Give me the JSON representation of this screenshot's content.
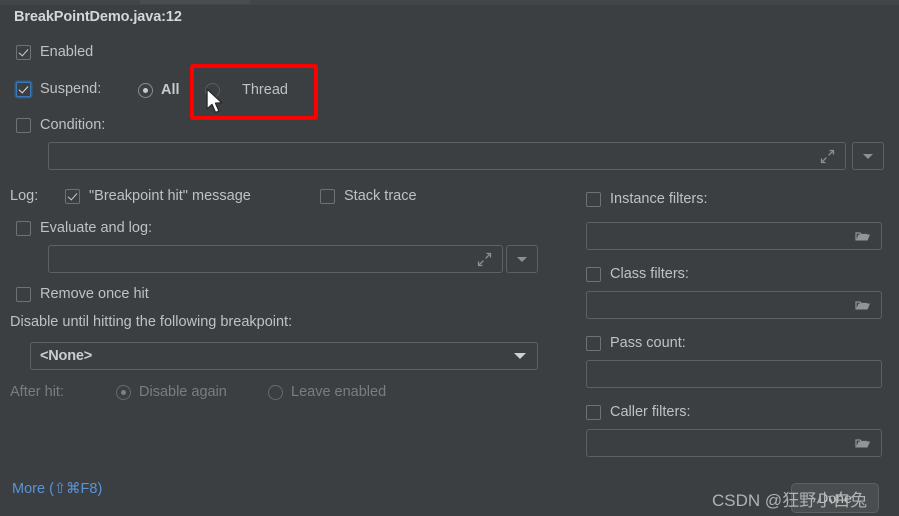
{
  "window": {
    "title": "BreakPointDemo.java:12",
    "background_color": "#3c3f41",
    "accent_color": "#5a93d8",
    "highlight_color": "#ff0000"
  },
  "left_column": {
    "enabled": {
      "label": "Enabled",
      "checked": true
    },
    "suspend": {
      "label": "Suspend:",
      "checked": true,
      "focused": true,
      "options": [
        {
          "label": "All",
          "selected": true
        },
        {
          "label": "Thread",
          "selected": false
        }
      ]
    },
    "condition": {
      "label": "Condition:",
      "checked": false,
      "value": "",
      "expand_icon": "expand-arrows-icon",
      "dropdown_icon": "chevron-down-icon"
    },
    "log": {
      "label": "Log:",
      "breakpoint_hit": {
        "label": "\"Breakpoint hit\" message",
        "checked": true
      },
      "stack_trace": {
        "label": "Stack trace",
        "checked": false
      }
    },
    "evaluate_and_log": {
      "label": "Evaluate and log:",
      "checked": false,
      "value": "",
      "expand_icon": "expand-arrows-icon",
      "dropdown_icon": "chevron-down-icon"
    },
    "remove_once_hit": {
      "label": "Remove once hit",
      "checked": false
    },
    "disable_until": {
      "label": "Disable until hitting the following breakpoint:",
      "selected_value": "<None>",
      "options": [
        "<None>"
      ]
    },
    "after_hit": {
      "label": "After hit:",
      "disabled": true,
      "options": [
        {
          "label": "Disable again",
          "selected": true
        },
        {
          "label": "Leave enabled",
          "selected": false
        }
      ]
    }
  },
  "right_column": {
    "instance_filters": {
      "label": "Instance filters:",
      "checked": false,
      "value": "",
      "browse_icon": "folder-icon"
    },
    "class_filters": {
      "label": "Class filters:",
      "checked": false,
      "value": "",
      "browse_icon": "folder-icon"
    },
    "pass_count": {
      "label": "Pass count:",
      "checked": false,
      "value": ""
    },
    "caller_filters": {
      "label": "Caller filters:",
      "checked": false,
      "value": "",
      "browse_icon": "folder-icon"
    }
  },
  "footer": {
    "more_link": "More (⇧⌘F8)",
    "done_button": "Done"
  },
  "overlay": {
    "watermark": "CSDN @狂野小白兔",
    "cursor": "mouse-pointer-icon"
  }
}
